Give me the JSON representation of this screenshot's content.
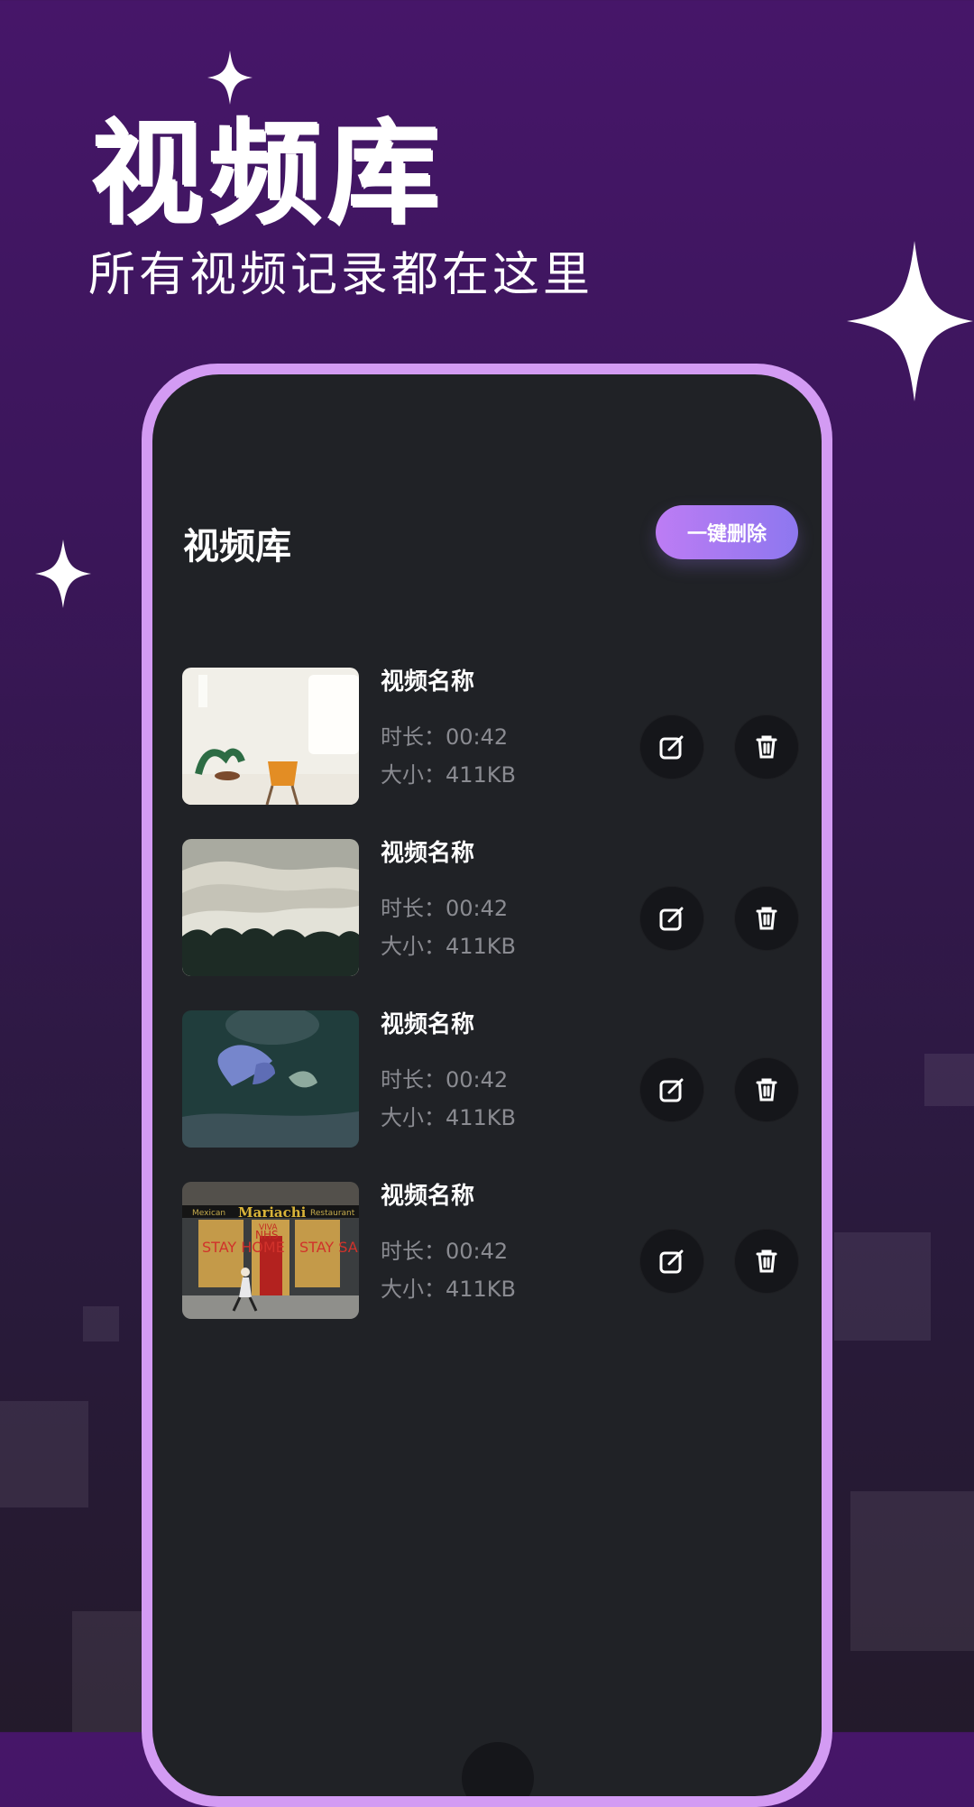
{
  "hero": {
    "title": "视频库",
    "subtitle": "所有视频记录都在这里"
  },
  "screen": {
    "title": "视频库",
    "delete_all_label": "一键删除"
  },
  "videos": [
    {
      "name": "视频名称",
      "duration": "时长：00:42",
      "size": "大小：411KB",
      "thumb": "room-chair-photo"
    },
    {
      "name": "视频名称",
      "duration": "时长：00:42",
      "size": "大小：411KB",
      "thumb": "snowy-hills-photo"
    },
    {
      "name": "视频名称",
      "duration": "时长：00:42",
      "size": "大小：411KB",
      "thumb": "butterfly-photo"
    },
    {
      "name": "视频名称",
      "duration": "时长：00:42",
      "size": "大小：411KB",
      "thumb": "shopfront-photo"
    }
  ],
  "thumb_texts": {
    "shop_left": "Mexican",
    "shop_name": "Mariachi",
    "shop_right": "Restaurant",
    "viva": "VIVA",
    "nhs": "NHS",
    "stay_home": "STAY\nHOME",
    "stay_safe": "STAY\nSAFE"
  },
  "colors": {
    "accent_start": "#bd7cf4",
    "accent_end": "#8d77ef",
    "phone_border": "#d39bf3",
    "screen_bg": "#202226"
  },
  "icons": {
    "edit": "edit-icon",
    "delete": "trash-icon",
    "sparkle": "sparkle-icon"
  }
}
